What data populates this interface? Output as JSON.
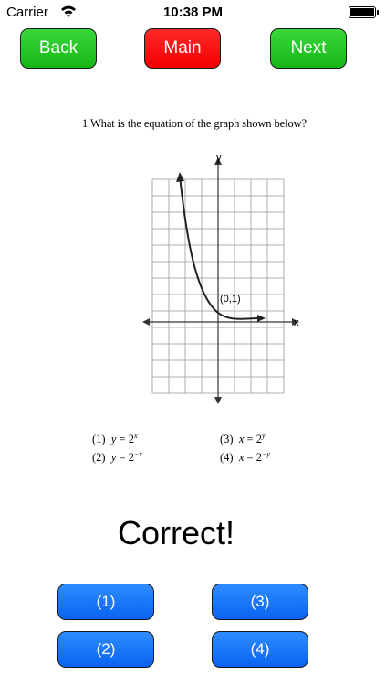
{
  "status_bar": {
    "carrier": "Carrier",
    "time": "10:38 PM",
    "wifi_icon": "wifi-icon",
    "battery_icon": "battery-icon",
    "battery_level": 1.0
  },
  "nav": {
    "back": "Back",
    "main": "Main",
    "next": "Next",
    "colors": {
      "back": "#22c322",
      "main": "#f80000",
      "next": "#22c322"
    }
  },
  "question": {
    "number": "1",
    "text": "What is the equation of the graph shown below?"
  },
  "graph": {
    "x_axis_label": "x",
    "y_axis_label": "y",
    "point_label": "(0,1)"
  },
  "choices": [
    {
      "num": "(1)",
      "lhs": "y",
      "base": "2",
      "exp": "x"
    },
    {
      "num": "(2)",
      "lhs": "y",
      "base": "2",
      "exp": "−x"
    },
    {
      "num": "(3)",
      "lhs": "x",
      "base": "2",
      "exp": "y"
    },
    {
      "num": "(4)",
      "lhs": "x",
      "base": "2",
      "exp": "−y"
    }
  ],
  "feedback": "Correct!",
  "answers": {
    "a1": "(1)",
    "a2": "(2)",
    "a3": "(3)",
    "a4": "(4)",
    "color": "#1a75ff"
  }
}
